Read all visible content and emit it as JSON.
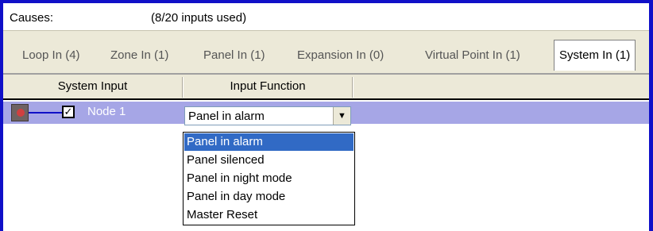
{
  "causes": {
    "label": "Causes:",
    "count": "(8/20 inputs used)"
  },
  "tabs": [
    {
      "label": "Loop In (4)"
    },
    {
      "label": "Zone In (1)"
    },
    {
      "label": "Panel In (1)"
    },
    {
      "label": "Expansion In (0)"
    },
    {
      "label": "Virtual Point In (1)"
    },
    {
      "label": "System In (1)",
      "active": true
    }
  ],
  "columns": {
    "system_input": "System Input",
    "input_function": "Input Function"
  },
  "row": {
    "checked": "✓",
    "name": "Node 1",
    "icon": "node-device-icon",
    "function_value": "Panel in alarm"
  },
  "dropdown": {
    "options": [
      "Panel in alarm",
      "Panel silenced",
      "Panel in night mode",
      "Panel in day mode",
      "Master Reset"
    ],
    "selected_index": 0
  },
  "colors": {
    "window_border": "#1010c8",
    "row_highlight": "#a6a6e6",
    "selection": "#316ac5",
    "tab_background": "#ece9d8"
  }
}
